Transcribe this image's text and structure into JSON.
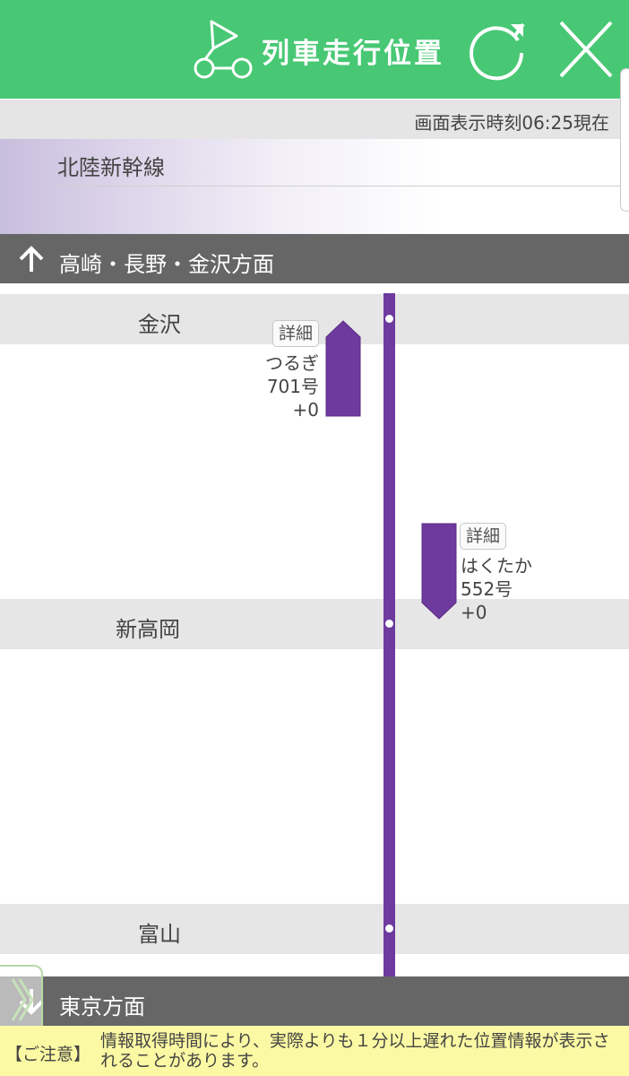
{
  "header": {
    "title": "列車走行位置",
    "logo_icon": "train-position-logo-icon",
    "refresh_icon": "refresh-icon",
    "close_icon": "close-icon",
    "color": "#48c874"
  },
  "timebar": {
    "text": "画面表示時刻06:25現在"
  },
  "line": {
    "name": "北陸新幹線",
    "color": "#6e3a9e"
  },
  "directions": {
    "up": {
      "label": "高崎・長野・金沢方面",
      "icon": "arrow-up-icon"
    },
    "down": {
      "label": "東京方面",
      "icon": "arrow-down-icon"
    }
  },
  "stations": [
    {
      "name": "金沢"
    },
    {
      "name": "新高岡"
    },
    {
      "name": "富山"
    }
  ],
  "trains": [
    {
      "detail_label": "詳細",
      "name": "つるぎ",
      "number": "701号",
      "delay": "+0",
      "direction": "up"
    },
    {
      "detail_label": "詳細",
      "name": "はくたか",
      "number": "552号",
      "delay": "+0",
      "direction": "down"
    }
  ],
  "notice": {
    "label": "【ご注意】",
    "text": "情報取得時間により、実際よりも１分以上遅れた位置情報が表示されることがあります。",
    "background": "#fbf9a3"
  }
}
